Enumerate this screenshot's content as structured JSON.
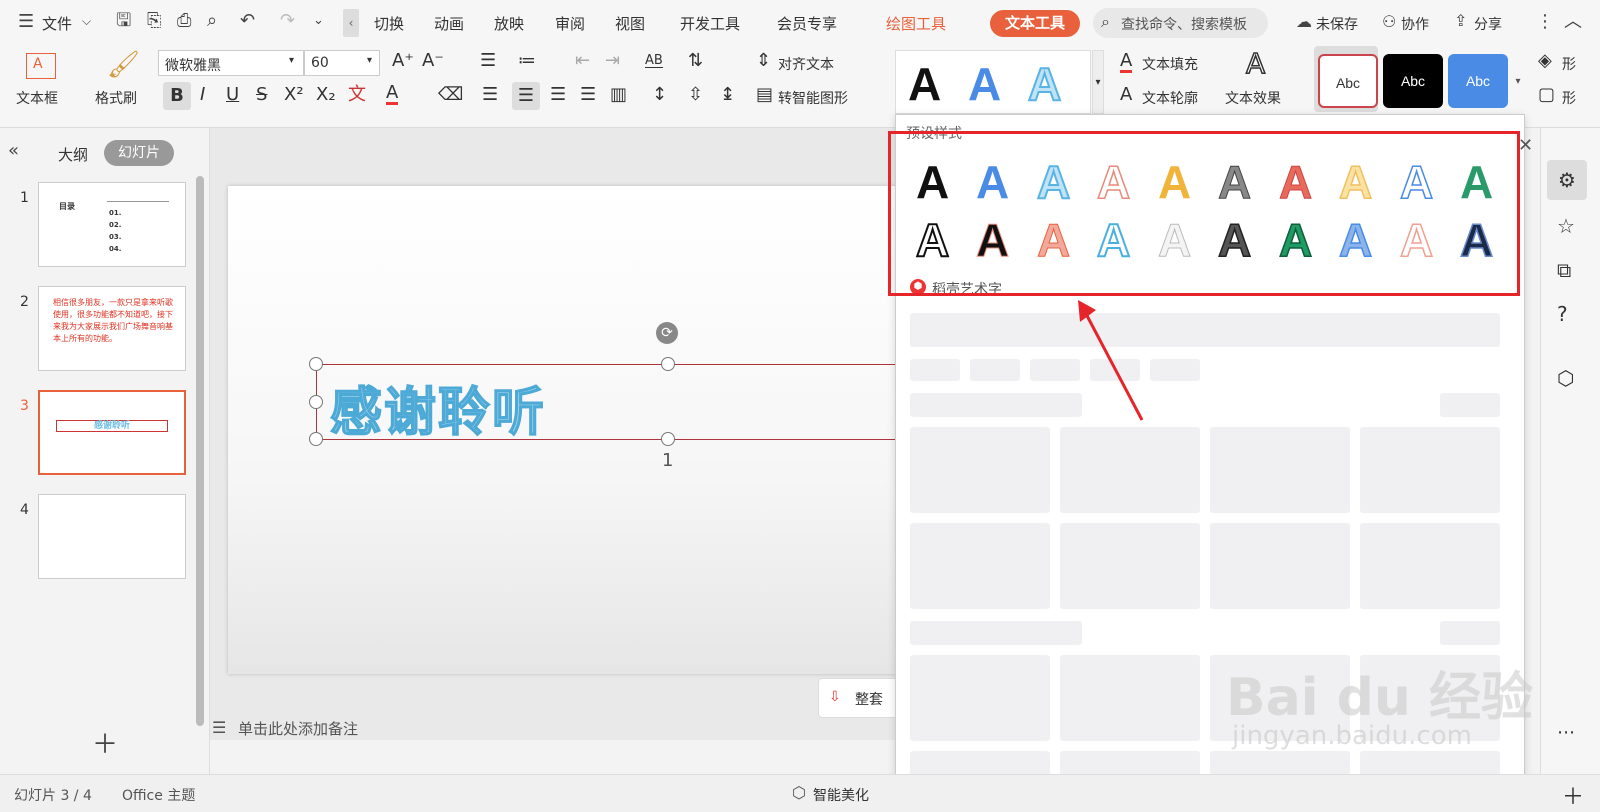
{
  "menubar": {
    "file": "文件",
    "tabs": [
      "切换",
      "动画",
      "放映",
      "审阅",
      "视图",
      "开发工具",
      "会员专享"
    ],
    "drawing_tools": "绘图工具",
    "text_tools": "文本工具",
    "search_placeholder": "查找命令、搜索模板",
    "unsaved": "未保存",
    "collaborate": "协作",
    "share": "分享"
  },
  "ribbon": {
    "textbox": "文本框",
    "format_painter": "格式刷",
    "font_name": "微软雅黑",
    "font_size": "60",
    "align_text": "对齐文本",
    "smart_shape": "转智能图形",
    "text_fill": "文本填充",
    "text_outline": "文本轮廓",
    "text_effect": "文本效果",
    "abc_labels": [
      "Abc",
      "Abc",
      "Abc"
    ],
    "shape_partial": [
      "形",
      "形"
    ],
    "colors": {
      "blue": "#4a8be6",
      "accent": "#e8613c"
    }
  },
  "left_panel": {
    "outline_tab": "大纲",
    "slides_tab": "幻灯片",
    "slide_numbers": [
      "1",
      "2",
      "3",
      "4"
    ],
    "slide1": {
      "title": "目录",
      "items": [
        "01.",
        "02.",
        "03.",
        "04."
      ]
    },
    "slide2_text": "相信很多朋友，一款只是拿来听歌使用，很多功能都不知道吧，接下来我为大家展示我们广场舞音响基本上所有的功能。",
    "slide3_text": "感谢聆听"
  },
  "slide": {
    "title": "感谢聆听",
    "placeholder_number": "1",
    "notes_placeholder": "单击此处添加备注",
    "partial_button": "整套"
  },
  "dropdown": {
    "preset_label": "预设样式",
    "shell_art_label": "稻壳艺术字",
    "preset_glyph": "A"
  },
  "statusbar": {
    "slide_info": "幻灯片 3 / 4",
    "theme": "Office 主题",
    "smart_beautify": "智能美化"
  },
  "watermark": {
    "brand": "Bai du 经验",
    "url": "jingyan.baidu.com"
  }
}
